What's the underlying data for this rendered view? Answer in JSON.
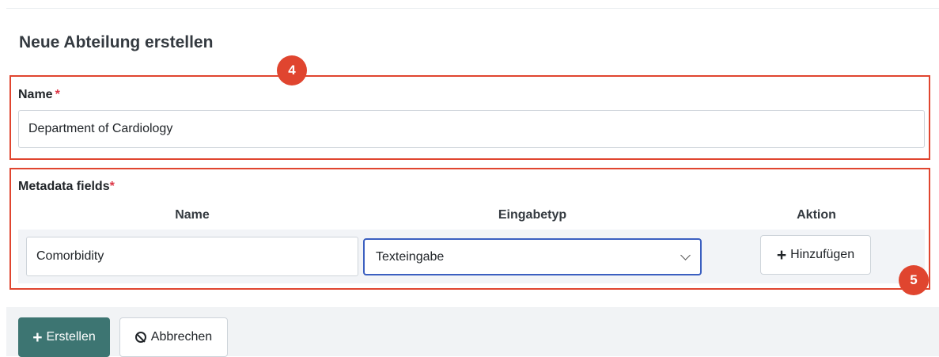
{
  "form": {
    "title": "Neue Abteilung erstellen",
    "name_label": "Name",
    "required_mark": "*",
    "name_value": "Department of Cardiology"
  },
  "metadata": {
    "label": "Metadata fields",
    "required_mark": "*",
    "columns": [
      "Name",
      "Eingabetyp",
      "Aktion"
    ],
    "row": {
      "name_value": "Comorbidity",
      "type_value": "Texteingabe",
      "add_label": "Hinzufügen"
    }
  },
  "annotations": {
    "badge_4": "4",
    "badge_5": "5",
    "highlight_color": "#e0452f"
  },
  "footer": {
    "create_label": "Erstellen",
    "cancel_label": "Abbrechen",
    "create_color": "#3d7572"
  },
  "icons": {
    "plus": "plus-icon",
    "ban": "ban-icon",
    "chevron": "chevron-down-icon"
  }
}
